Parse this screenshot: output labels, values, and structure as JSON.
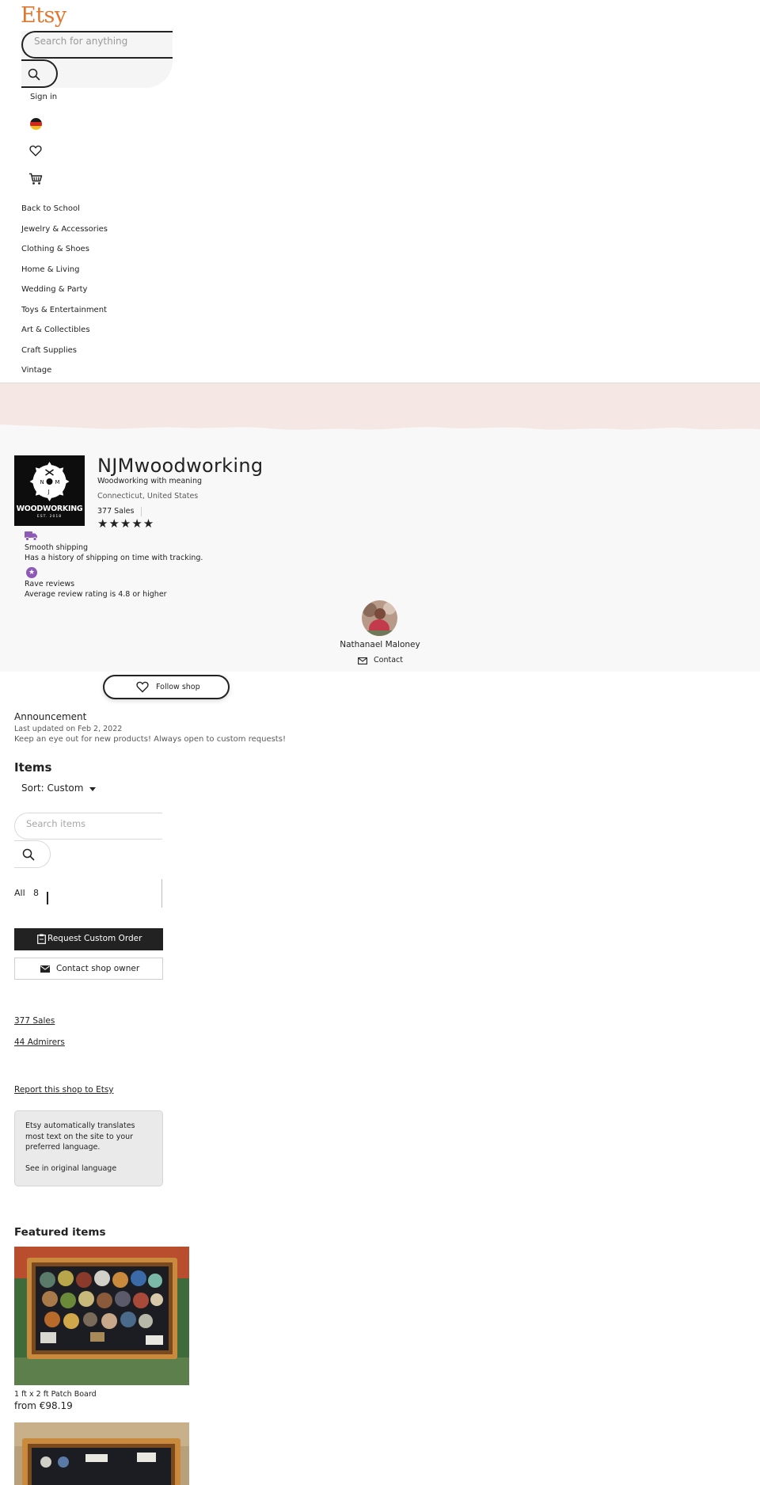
{
  "header": {
    "logo": "Etsy",
    "search_placeholder": "Search for anything",
    "sign_in": "Sign in",
    "categories": [
      "Back to School",
      "Jewelry & Accessories",
      "Clothing & Shoes",
      "Home & Living",
      "Wedding & Party",
      "Toys & Entertainment",
      "Art & Collectibles",
      "Craft Supplies",
      "Vintage"
    ]
  },
  "shop": {
    "logo_text": "WOODWORKING",
    "logo_sub": "EST. 2018",
    "name": "NJMwoodworking",
    "tagline": "Woodworking with meaning",
    "location": "Connecticut, United States",
    "sales": "377 Sales",
    "stars": "★★★★★",
    "rating": 5
  },
  "badges": [
    {
      "title": "Smooth shipping",
      "desc": "Has a history of shipping on time with tracking."
    },
    {
      "title": "Rave reviews",
      "desc": "Average review rating is 4.8 or higher"
    }
  ],
  "owner": {
    "name": "Nathanael Maloney",
    "contact": "Contact"
  },
  "follow_label": "Follow shop",
  "announcement": {
    "title": "Announcement",
    "date": "Last updated on Feb 2, 2022",
    "text": "Keep an eye out for new products! Always open to custom requests!"
  },
  "items": {
    "heading": "Items",
    "sort": "Sort: Custom",
    "search_placeholder": "Search items",
    "filter_label": "All",
    "filter_count": "8"
  },
  "actions": {
    "request_custom": "Request Custom Order",
    "contact_owner": "Contact shop owner"
  },
  "stats": {
    "sales_link": "377 Sales",
    "admirers_link": "44 Admirers",
    "report_link": "Report this shop to Etsy"
  },
  "translate": {
    "text": "Etsy automatically translates most text on the site to your preferred language.",
    "see_original": "See in original language"
  },
  "featured": {
    "heading": "Featured items",
    "items": [
      {
        "title": "1 ft x 2 ft Patch Board",
        "price": "from €98.19"
      },
      {
        "title": "",
        "price": ""
      }
    ]
  },
  "colors": {
    "brand": "#e0772f",
    "banner_pink": "#f5e8e4",
    "badge_purple": "#8d5ab8",
    "dark_button": "#222222"
  }
}
